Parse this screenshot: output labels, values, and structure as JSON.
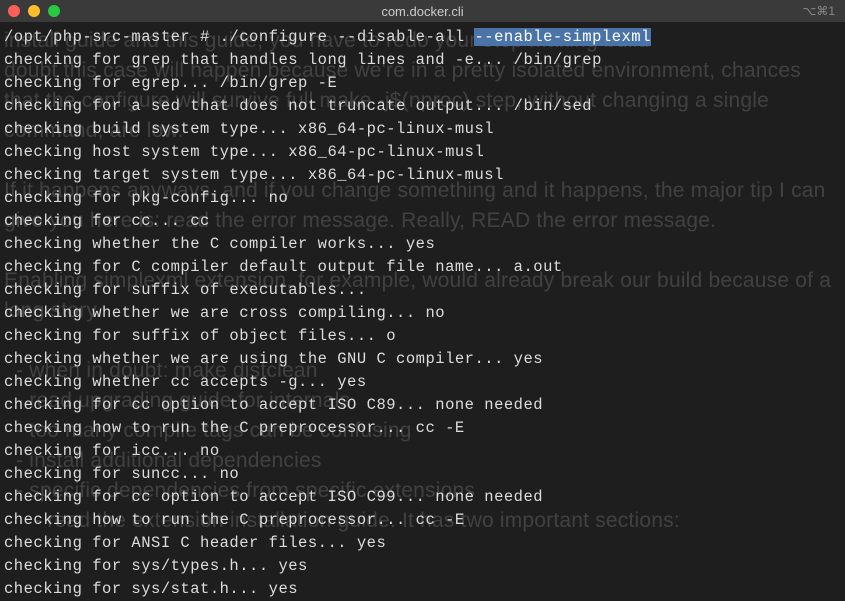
{
  "window": {
    "title": "com.docker.cli",
    "shortcut": "⌥⌘1"
  },
  "prompt": {
    "path": "/opt/php-src-master # ",
    "cmd_part1": "./configure --disable-all ",
    "cmd_selected": "--enable-simplexml"
  },
  "lines": [
    "checking for grep that handles long lines and -e... /bin/grep",
    "checking for egrep... /bin/grep -E",
    "checking for a sed that does not truncate output... /bin/sed",
    "checking build system type... x86_64-pc-linux-musl",
    "checking host system type... x86_64-pc-linux-musl",
    "checking target system type... x86_64-pc-linux-musl",
    "checking for pkg-config... no",
    "checking for cc... cc",
    "checking whether the C compiler works... yes",
    "checking for C compiler default output file name... a.out",
    "checking for suffix of executables...",
    "checking whether we are cross compiling... no",
    "checking for suffix of object files... o",
    "checking whether we are using the GNU C compiler... yes",
    "checking whether cc accepts -g... yes",
    "checking for cc option to accept ISO C89... none needed",
    "checking how to run the C preprocessor... cc -E",
    "checking for icc... no",
    "checking for suncc... no",
    "checking for cc option to accept ISO C99... none needed",
    "checking how to run the C preprocessor... cc -E",
    "checking for ANSI C header files... yes",
    "checking for sys/types.h... yes",
    "checking for sys/stat.h... yes"
  ],
  "background_text": "install guide and this guide, you have to redo your step making build\ndoubt this case will happen because we're in a pretty isolated environment, chances that the configure will survive full make -j$(nproc) step, without changing a single command, are low.\n\nIf it happens anyways, and if you change something and it happens, the major tip I can give you here is: read the error message. Really, READ the error message.\n\nEnabling simplexml extension, for example, would already break our build because of a long story.\n\n  - when in doubt: make distclean\n  - read upgrading guide for internals\n  - too many compile tags can be confusing\n  - install additional dependencies\n  - specific dependencies from specific extensions\n     - read the extension installation guide. It has two important sections:"
}
